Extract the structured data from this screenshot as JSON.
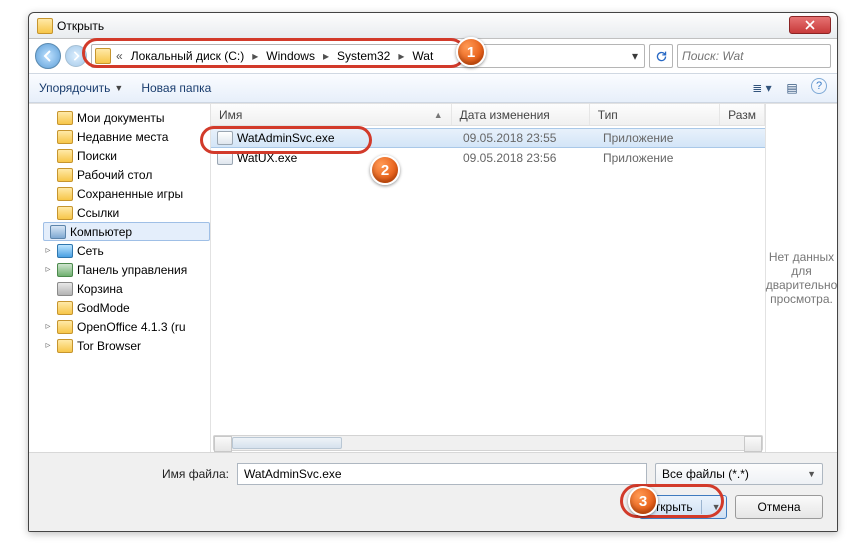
{
  "window": {
    "title": "Открыть"
  },
  "nav": {
    "breadcrumb": {
      "chev": "«",
      "p1": "Локальный диск (C:)",
      "p2": "Windows",
      "p3": "System32",
      "p4": "Wat",
      "sep": "▸"
    },
    "search_placeholder": "Поиск: Wat"
  },
  "toolbar": {
    "organize": "Упорядочить",
    "newfolder": "Новая папка"
  },
  "tree": {
    "items": [
      {
        "label": "Мои документы",
        "icon": "ic-folder"
      },
      {
        "label": "Недавние места",
        "icon": "ic-folder"
      },
      {
        "label": "Поиски",
        "icon": "ic-folder"
      },
      {
        "label": "Рабочий стол",
        "icon": "ic-folder"
      },
      {
        "label": "Сохраненные игры",
        "icon": "ic-folder"
      },
      {
        "label": "Ссылки",
        "icon": "ic-folder"
      },
      {
        "label": "Компьютер",
        "icon": "ic-drive",
        "selected": true,
        "expander": "▹"
      },
      {
        "label": "Сеть",
        "icon": "ic-net",
        "expander": "▹"
      },
      {
        "label": "Панель управления",
        "icon": "ic-cpanel",
        "expander": "▹"
      },
      {
        "label": "Корзина",
        "icon": "ic-bin"
      },
      {
        "label": "GodMode",
        "icon": "ic-folder"
      },
      {
        "label": "OpenOffice 4.1.3 (ru",
        "icon": "ic-folder",
        "expander": "▹"
      },
      {
        "label": "Tor Browser",
        "icon": "ic-folder",
        "expander": "▹"
      }
    ]
  },
  "columns": {
    "name": "Имя",
    "date": "Дата изменения",
    "type": "Тип",
    "size": "Разм"
  },
  "files": [
    {
      "name": "WatAdminSvc.exe",
      "date": "09.05.2018 23:55",
      "type": "Приложение",
      "selected": true
    },
    {
      "name": "WatUX.exe",
      "date": "09.05.2018 23:56",
      "type": "Приложение"
    }
  ],
  "preview": {
    "text": "Нет данных для дварительно просмотра."
  },
  "footer": {
    "filename_label": "Имя файла:",
    "filename_value": "WatAdminSvc.exe",
    "filter": "Все файлы (*.*)",
    "open": "Открыть",
    "cancel": "Отмена"
  },
  "badges": {
    "b1": "1",
    "b2": "2",
    "b3": "3"
  }
}
